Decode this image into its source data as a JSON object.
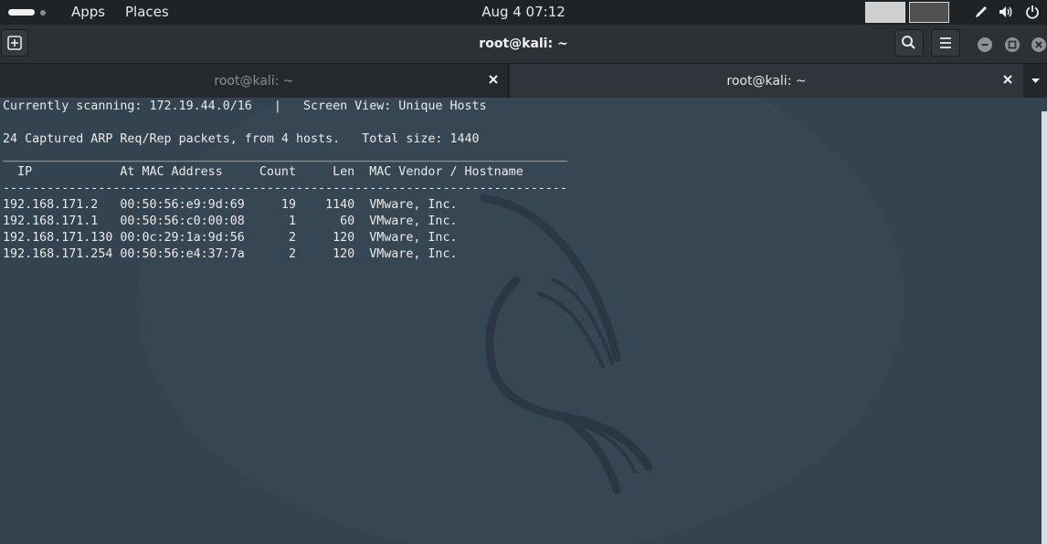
{
  "topbar": {
    "apps_label": "Apps",
    "places_label": "Places",
    "clock": "Aug 4  07:12"
  },
  "window": {
    "title": "root@kali: ~"
  },
  "tabs": [
    {
      "label": "root@kali: ~",
      "active": false
    },
    {
      "label": "root@kali: ~",
      "active": true
    }
  ],
  "terminal": {
    "lines": [
      "Currently scanning: 172.19.44.0/16   |   Screen View: Unique Hosts",
      "",
      "24 Captured ARP Req/Rep packets, from 4 hosts.   Total size: 1440",
      "_____________________________________________________________________________",
      "  IP            At MAC Address     Count     Len  MAC Vendor / Hostname",
      "-----------------------------------------------------------------------------",
      "192.168.171.2   00:50:56:e9:9d:69     19    1140  VMware, Inc.",
      "192.168.171.1   00:50:56:c0:00:08      1      60  VMware, Inc.",
      "192.168.171.130 00:0c:29:1a:9d:56      2     120  VMware, Inc.",
      "192.168.171.254 00:50:56:e4:37:7a      2     120  VMware, Inc."
    ]
  },
  "icons": {
    "new_tab": "new-tab-icon",
    "search": "search-icon",
    "menu": "hamburger-menu-icon",
    "minimize": "minimize-icon",
    "maximize": "maximize-icon",
    "close": "close-icon",
    "tab_close": "close-icon",
    "tab_list": "chevron-down-icon",
    "pen": "pen-icon",
    "volume": "volume-icon",
    "power": "power-icon"
  },
  "colors": {
    "terminal_bg": "#344350",
    "terminal_text": "#eaeaea",
    "topbar_bg": "#1f2326"
  }
}
